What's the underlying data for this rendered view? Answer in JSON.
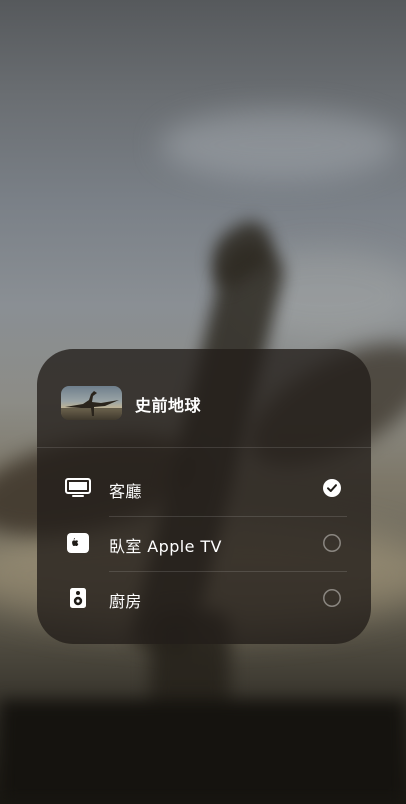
{
  "now_playing": {
    "title": "史前地球",
    "artwork_icon": "pterosaur-artwork"
  },
  "devices": [
    {
      "label": "客廳",
      "icon": "tv-icon",
      "selected": true
    },
    {
      "label": "臥室 Apple TV",
      "icon": "apple-tv-icon",
      "selected": false
    },
    {
      "label": "廚房",
      "icon": "speaker-icon",
      "selected": false
    }
  ],
  "apple_tv_badge": "tv",
  "colors": {
    "panel": "#221e1a",
    "text": "#ffffff",
    "checkmark_fill": "#ffffff",
    "radio_stroke": "#8a8680"
  }
}
